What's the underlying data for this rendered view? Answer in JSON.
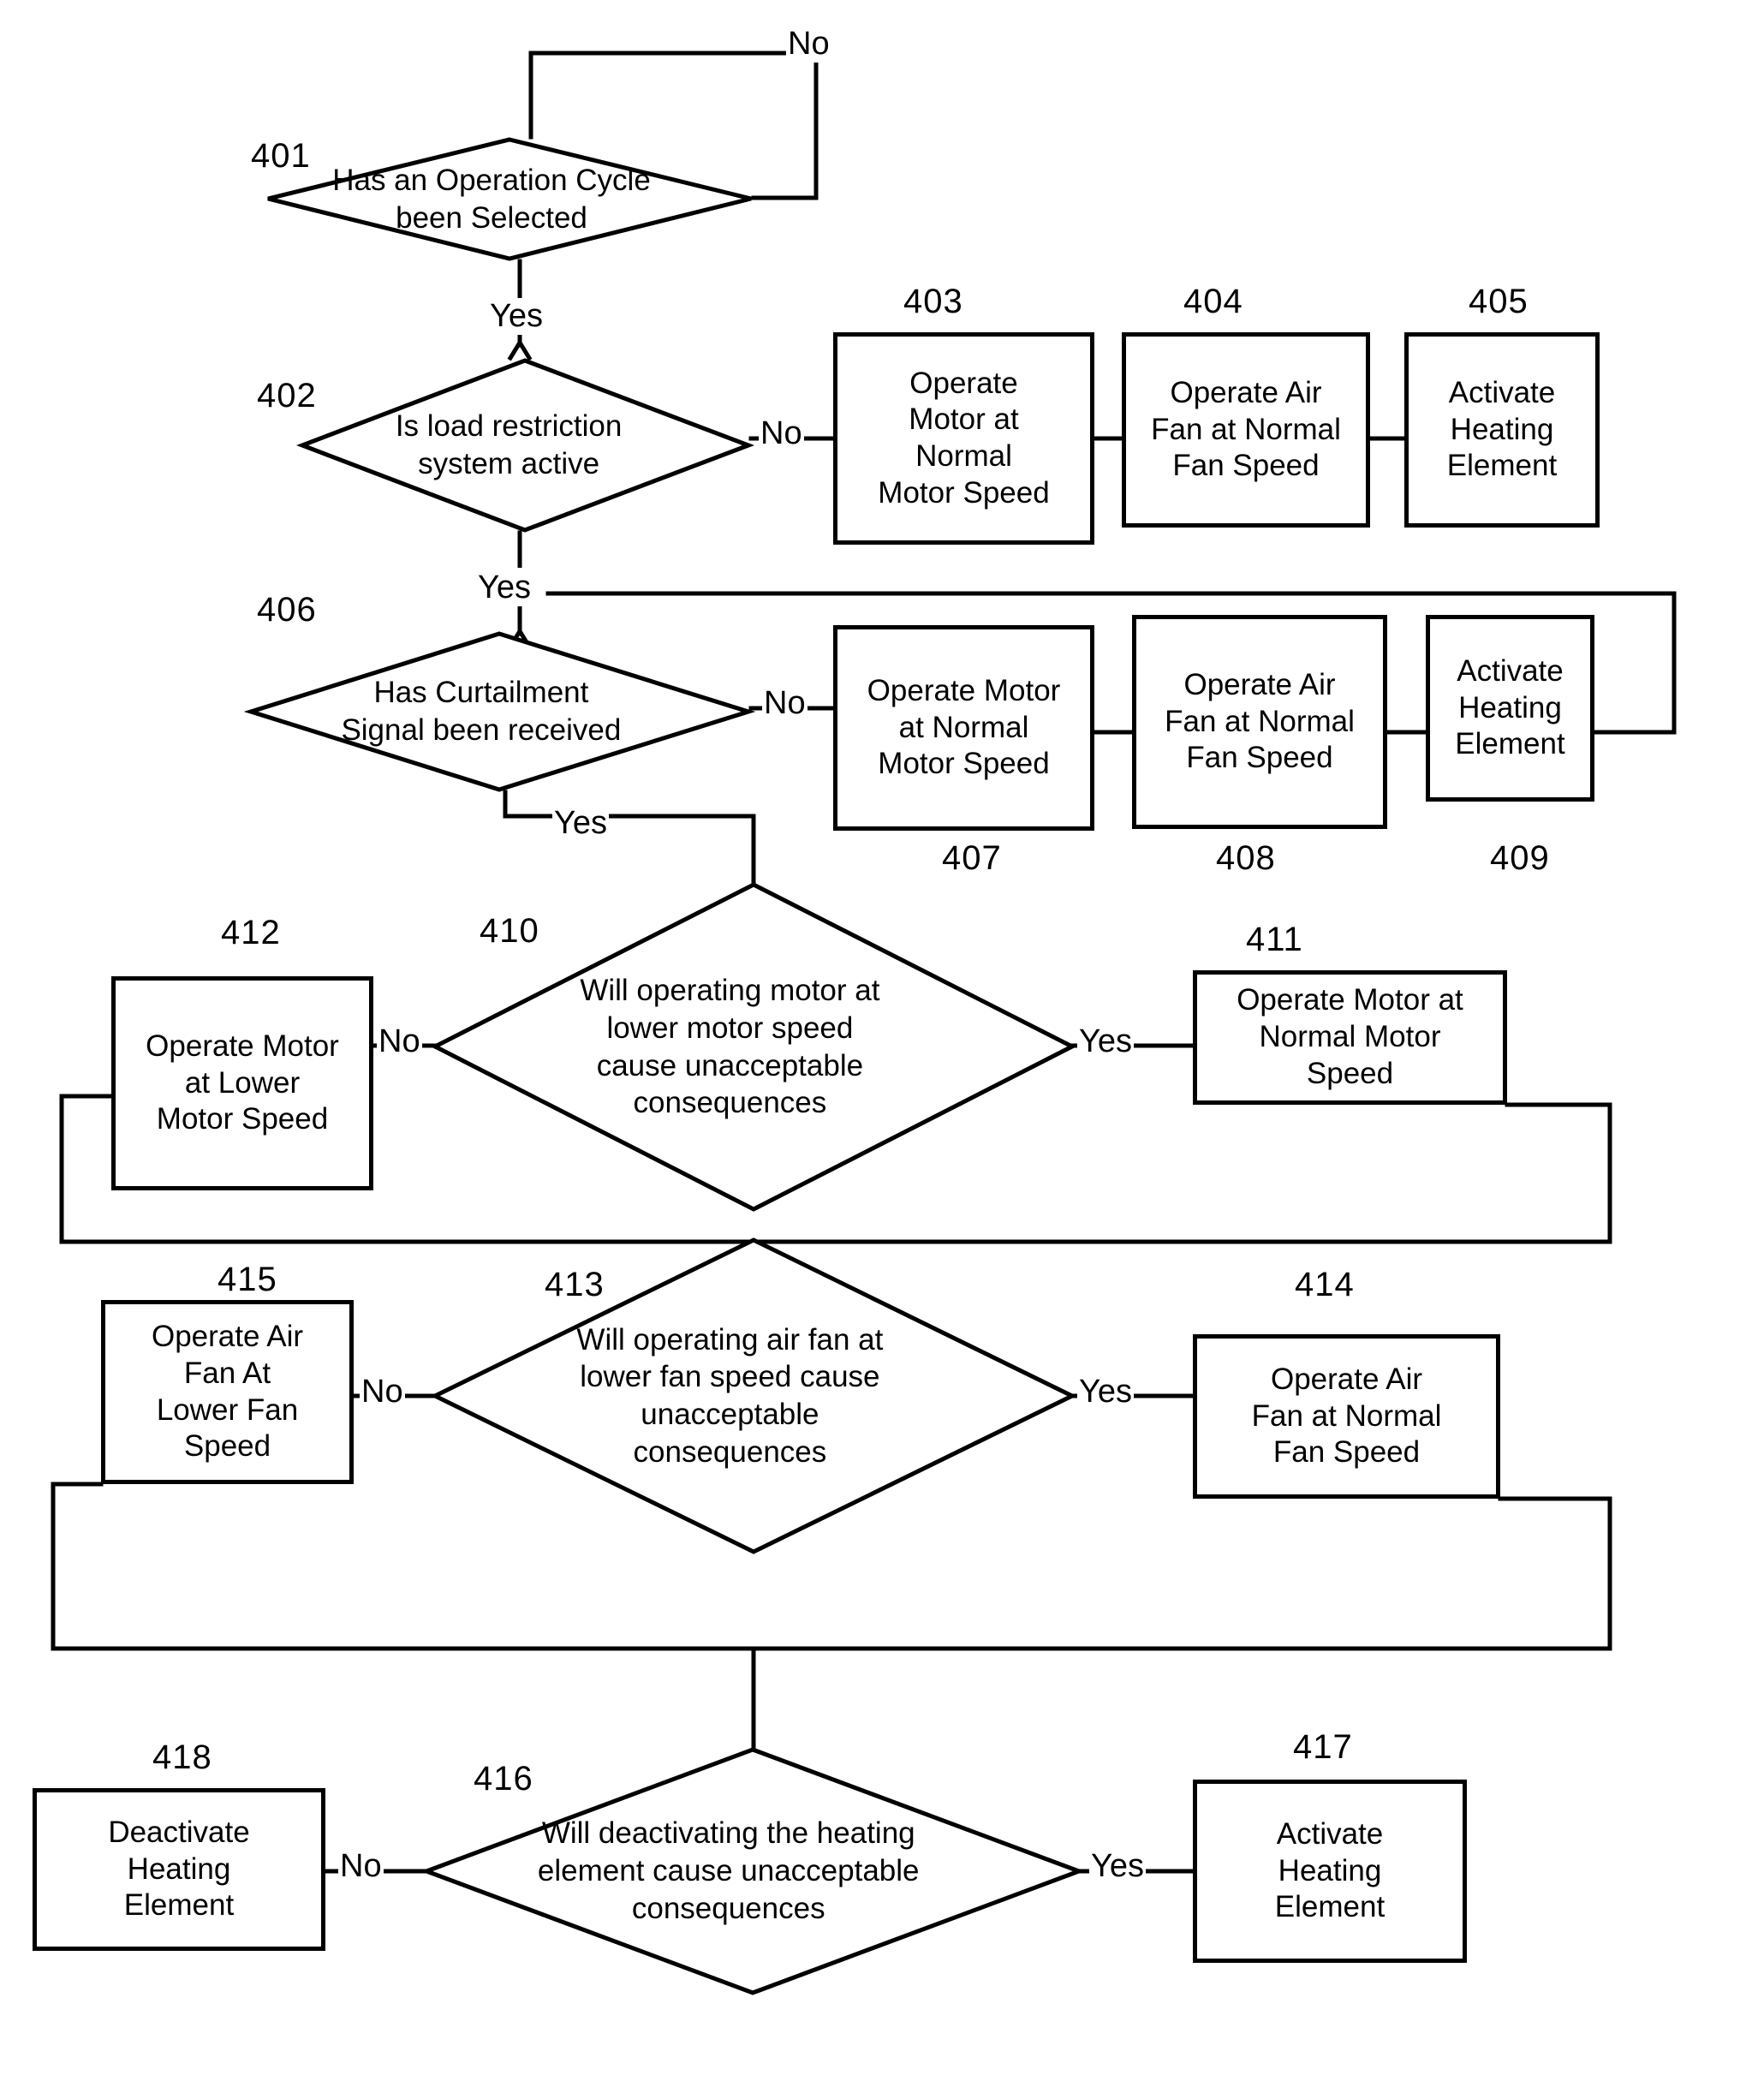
{
  "figure": {
    "type": "patent-flowchart",
    "decisions": [
      {
        "ref": "401",
        "text_lines": [
          "Has an Operation Cycle",
          "been Selected"
        ],
        "yes_label": "Yes",
        "no_label": "No"
      },
      {
        "ref": "402",
        "text_lines": [
          "Is load restriction",
          "system active"
        ],
        "yes_label": "Yes",
        "no_label": "No"
      },
      {
        "ref": "406",
        "text_lines": [
          "Has Curtailment",
          "Signal been received"
        ],
        "yes_label": "Yes",
        "no_label": "No"
      },
      {
        "ref": "410",
        "text_lines": [
          "Will operating motor at",
          "lower motor speed",
          "cause unacceptable",
          "consequences"
        ],
        "yes_label": "Yes",
        "no_label": "No"
      },
      {
        "ref": "413",
        "text_lines": [
          "Will operating air fan at",
          "lower fan speed cause",
          "unacceptable",
          "consequences"
        ],
        "yes_label": "Yes",
        "no_label": "No"
      },
      {
        "ref": "416",
        "text_lines": [
          "Will deactivating the heating",
          "element cause unacceptable",
          "consequences"
        ],
        "yes_label": "Yes",
        "no_label": "No"
      }
    ],
    "processes": [
      {
        "ref": "403",
        "text_lines": [
          "Operate",
          "Motor at",
          "Normal",
          "Motor Speed"
        ]
      },
      {
        "ref": "404",
        "text_lines": [
          "Operate Air",
          "Fan at Normal",
          "Fan Speed"
        ]
      },
      {
        "ref": "405",
        "text_lines": [
          "Activate",
          "Heating",
          "Element"
        ]
      },
      {
        "ref": "407",
        "text_lines": [
          "Operate   Motor",
          "at Normal",
          "Motor Speed"
        ]
      },
      {
        "ref": "408",
        "text_lines": [
          "Operate Air",
          "Fan at Normal",
          "Fan Speed"
        ]
      },
      {
        "ref": "409",
        "text_lines": [
          "Activate",
          "Heating",
          "Element"
        ]
      },
      {
        "ref": "411",
        "text_lines": [
          "Operate Motor at",
          "Normal Motor",
          "Speed"
        ]
      },
      {
        "ref": "412",
        "text_lines": [
          "Operate Motor",
          "at Lower",
          "Motor Speed"
        ]
      },
      {
        "ref": "414",
        "text_lines": [
          "Operate Air",
          "Fan at Normal",
          "Fan Speed"
        ]
      },
      {
        "ref": "415",
        "text_lines": [
          "Operate Air",
          "Fan At",
          "Lower Fan",
          "Speed"
        ]
      },
      {
        "ref": "417",
        "text_lines": [
          "Activate",
          "Heating",
          "Element"
        ]
      },
      {
        "ref": "418",
        "text_lines": [
          "Deactivate",
          "Heating",
          "Element"
        ]
      }
    ],
    "edge_labels": {
      "d401_no": "No",
      "d401_yes": "Yes",
      "d402_no": "No",
      "d402_yes": "Yes",
      "d406_no": "No",
      "d406_yes": "Yes",
      "d410_no": "No",
      "d410_yes": "Yes",
      "d413_no": "No",
      "d413_yes": "Yes",
      "d416_no": "No",
      "d416_yes": "Yes"
    },
    "colors": {
      "stroke": "#000000",
      "fill": "#ffffff",
      "text": "#000000"
    }
  }
}
